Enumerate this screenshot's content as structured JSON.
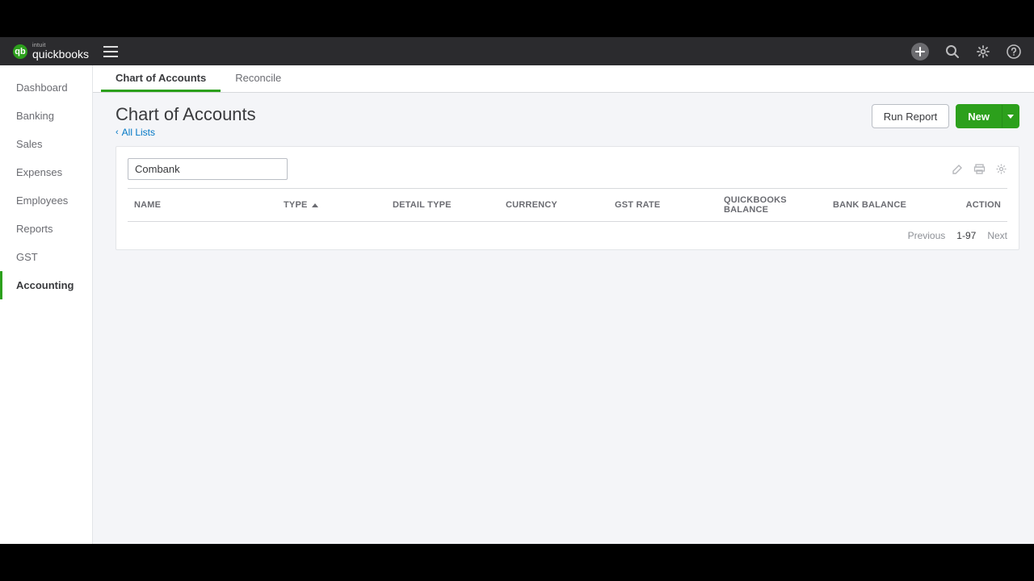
{
  "brand": {
    "small": "intuit",
    "big": "quickbooks"
  },
  "sidebar": {
    "items": [
      {
        "label": "Dashboard"
      },
      {
        "label": "Banking"
      },
      {
        "label": "Sales"
      },
      {
        "label": "Expenses"
      },
      {
        "label": "Employees"
      },
      {
        "label": "Reports"
      },
      {
        "label": "GST"
      },
      {
        "label": "Accounting"
      }
    ]
  },
  "tabs": [
    {
      "label": "Chart of Accounts"
    },
    {
      "label": "Reconcile"
    }
  ],
  "page": {
    "title": "Chart of Accounts",
    "breadcrumb": "All Lists",
    "search_value": "Combank"
  },
  "actions": {
    "run_report": "Run Report",
    "new": "New"
  },
  "columns": {
    "name": "NAME",
    "type": "TYPE",
    "detail_type": "DETAIL TYPE",
    "currency": "CURRENCY",
    "gst_rate": "GST RATE",
    "qb_balance": "QUICKBOOKS BALANCE",
    "bank_balance": "BANK BALANCE",
    "action": "ACTION"
  },
  "pager": {
    "previous": "Previous",
    "range": "1-97",
    "next": "Next"
  }
}
